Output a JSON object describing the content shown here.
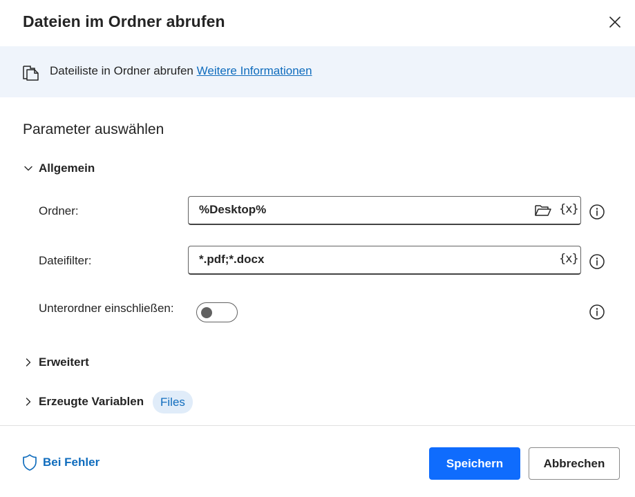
{
  "dialog": {
    "title": "Dateien im Ordner abrufen",
    "close_icon": "close-icon"
  },
  "banner": {
    "text": "Dateiliste in Ordner abrufen",
    "link": "Weitere Informationen",
    "icon": "files-icon"
  },
  "section": {
    "title": "Parameter auswählen"
  },
  "general": {
    "label": "Allgemein",
    "expanded": true,
    "fields": {
      "folder": {
        "label": "Ordner:",
        "value": "%Desktop%",
        "var_icon": "{x}"
      },
      "filter": {
        "label": "Dateifilter:",
        "value": "*.pdf;*.docx",
        "var_icon": "{x}"
      },
      "subfolders": {
        "label": "Unterordner einschließen:",
        "toggle_on": false
      }
    }
  },
  "advanced": {
    "label": "Erweitert",
    "expanded": false
  },
  "variables": {
    "label": "Erzeugte Variablen",
    "expanded": false,
    "pill": "Files"
  },
  "footer": {
    "on_error": "Bei Fehler",
    "save": "Speichern",
    "cancel": "Abbrechen"
  },
  "colors": {
    "accent": "#0f6cbd",
    "primary_button": "#0f6cfd",
    "banner_bg": "#eff4fb",
    "pill_bg": "#e0ecf9"
  }
}
